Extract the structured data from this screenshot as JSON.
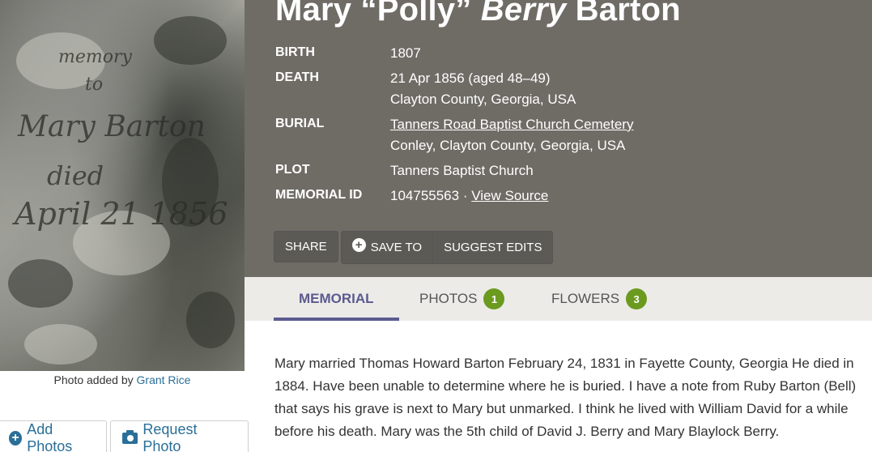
{
  "photo": {
    "engraving_lines": [
      "memory",
      "to",
      "Mary Barton",
      "died",
      "April 21 1856"
    ],
    "credit_prefix": "Photo added by",
    "credit_name": "Grant Rice",
    "add_photos_label": "Add Photos",
    "request_photo_label": "Request Photo"
  },
  "memorial": {
    "name_first": "Mary “Polly”",
    "name_maiden": "Berry",
    "name_last": "Barton",
    "facts": {
      "birth_label": "BIRTH",
      "birth_value": "1807",
      "death_label": "DEATH",
      "death_value": "21 Apr 1856 (aged 48–49)",
      "death_place": "Clayton County, Georgia, USA",
      "burial_label": "BURIAL",
      "burial_cemetery": "Tanners Road Baptist Church Cemetery",
      "burial_place": "Conley, Clayton County, Georgia, USA",
      "plot_label": "PLOT",
      "plot_value": "Tanners Baptist Church",
      "memorial_id_label": "MEMORIAL ID",
      "memorial_id_value": "104755563 ·",
      "view_source_label": "View Source"
    },
    "actions": {
      "share": "SHARE",
      "save_to": "SAVE TO",
      "suggest_edits": "SUGGEST EDITS"
    }
  },
  "tabs": [
    {
      "label": "MEMORIAL",
      "active": true
    },
    {
      "label": "PHOTOS",
      "count": "1"
    },
    {
      "label": "FLOWERS",
      "count": "3"
    }
  ],
  "bio": "Mary married Thomas Howard Barton February 24, 1831 in Fayette County, Georgia He died in 1884. Have been unable to determine where he is buried. I have a note from Ruby Barton (Bell) that says his grave is next to Mary but unmarked. I think he lived with William David for a while before his death. Mary was the 5th child of David J. Berry and Mary Blaylock Berry.",
  "colors": {
    "header_bg": "#6f6c66",
    "tab_active": "#5b5a8f",
    "badge": "#6b9a1f",
    "link": "#2a6f97"
  }
}
